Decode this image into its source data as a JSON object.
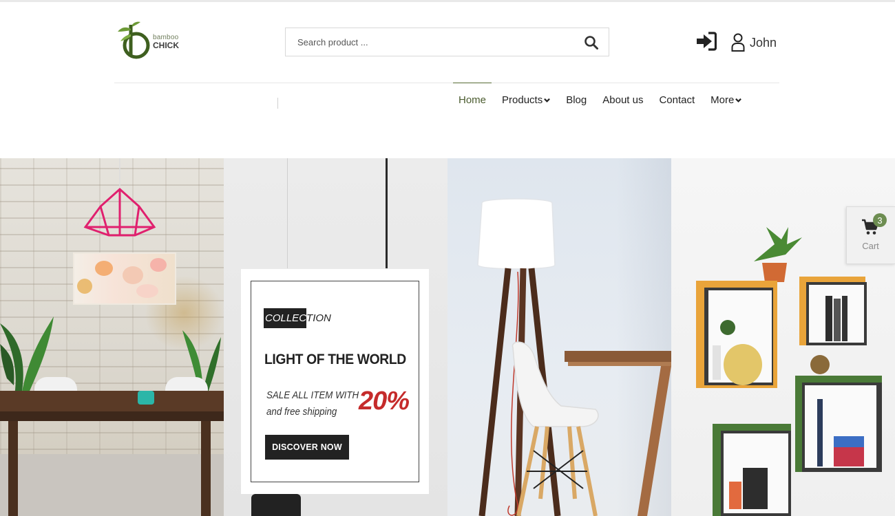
{
  "brand": {
    "name_top": "bamboo",
    "name_bottom": "CHICK",
    "color": "#4a6b2a"
  },
  "header": {
    "search": {
      "placeholder": "Search product ...",
      "value": ""
    },
    "icons": {
      "search": "search-icon",
      "login": "sign-in-icon",
      "user": "user-icon"
    },
    "user_name": "John"
  },
  "nav": {
    "items": [
      {
        "label": "Home",
        "active": true
      },
      {
        "label": "Products",
        "dropdown": true
      },
      {
        "label": "Blog"
      },
      {
        "label": "About us"
      },
      {
        "label": "Contact"
      },
      {
        "label": "More",
        "dropdown": true
      }
    ]
  },
  "promo": {
    "tag_dark": "COLLEC",
    "tag_light": "TION",
    "title": "LIGHT OF THE WORLD",
    "sale_line1": "SALE ALL ITEM WITH",
    "sale_line2": "and free shipping",
    "percent": "20%",
    "cta": "DISCOVER NOW",
    "accent_color": "#c52b2b"
  },
  "cart": {
    "count": "3",
    "label": "Cart",
    "badge_color": "#6d8d51"
  }
}
